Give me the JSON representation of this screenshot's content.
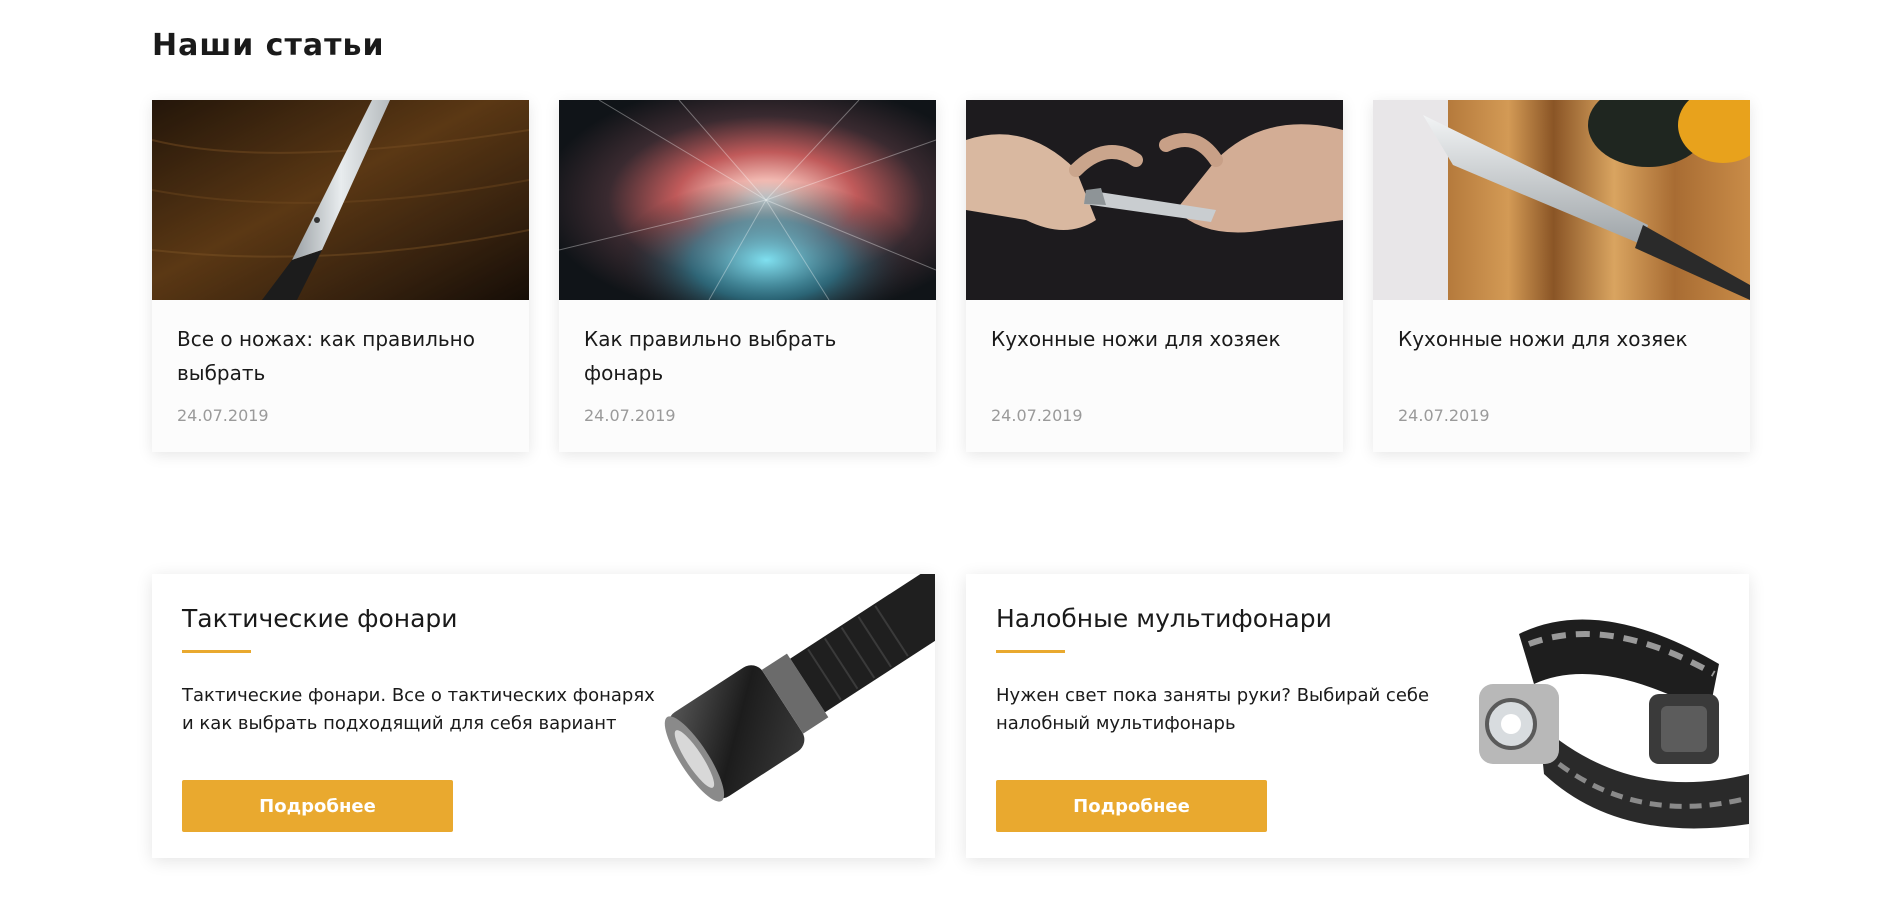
{
  "section": {
    "title": "Наши статьи"
  },
  "articles": [
    {
      "title": "Все о ножах: как правильно выбрать",
      "date": "24.07.2019",
      "image": "knife-on-wooden-board-photo"
    },
    {
      "title": "Как правильно выбрать фонарь",
      "date": "24.07.2019",
      "image": "light-burst-photo"
    },
    {
      "title": "Кухонные ножи для хозяек",
      "date": "24.07.2019",
      "image": "hands-sharpening-knife-photo"
    },
    {
      "title": "Кухонные ножи для хозяек",
      "date": "24.07.2019",
      "image": "chef-knife-cutting-board-photo"
    }
  ],
  "promos": [
    {
      "title": "Тактические фонари",
      "text": "Тактические фонари. Все о тактических фонарях и как выбрать подходящий для себя вариант",
      "button": "Подробнее",
      "image": "tactical-flashlight-image"
    },
    {
      "title": "Налобные мультифонари",
      "text": "Нужен свет пока заняты руки? Выбирай себе налобный мультифонарь",
      "button": "Подробнее",
      "image": "headlamp-image"
    }
  ],
  "colors": {
    "accent": "#e9a92f",
    "date": "#9a9a9a",
    "text": "#1a1a1a"
  }
}
